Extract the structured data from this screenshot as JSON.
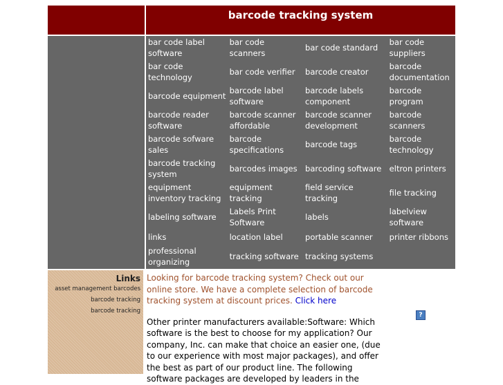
{
  "header": {
    "title": "barcode tracking system"
  },
  "nav_links": [
    [
      "bar code label software",
      "bar code scanners",
      "bar code standard",
      "bar code suppliers"
    ],
    [
      "bar code technology",
      "bar code verifier",
      "barcode creator",
      "barcode documentation"
    ],
    [
      "barcode equipment",
      "barcode label software",
      "barcode labels component",
      "barcode program"
    ],
    [
      "barcode reader software",
      "barcode scanner affordable",
      "barcode scanner development",
      "barcode scanners"
    ],
    [
      "barcode sofware sales",
      "barcode specifications",
      "barcode tags",
      "barcode technology"
    ],
    [
      "barcode tracking system",
      "barcodes images",
      "barcoding software",
      "eltron printers"
    ],
    [
      "equipment inventory tracking",
      "equipment tracking",
      "field service tracking",
      "file tracking"
    ],
    [
      "labeling software",
      "Labels Print Software",
      "labels",
      "labelview software"
    ],
    [
      "links",
      "location label",
      "portable scanner",
      "printer ribbons"
    ],
    [
      "professional organizing",
      "tracking software",
      "tracking systems",
      ""
    ]
  ],
  "sidebar": {
    "heading": "Links",
    "items": [
      "asset management barcodes",
      "barcode tracking",
      "barcode tracking"
    ]
  },
  "content": {
    "promo_text": "Looking for barcode tracking system? Check out our online store. We have a complete selection of barcode tracking system at discount prices.",
    "promo_link": "Click here",
    "body_text": "Other printer manufacturers available:Software: Which software is the best to choose for my application? Our company, Inc. can make that choice an easier one, (due to our experience with most major packages), and offer the best as part of our product line. The following software packages are developed by leaders in the",
    "help_icon_label": "?"
  },
  "colors": {
    "header_bg": "#800000",
    "nav_bg": "#666666",
    "sidebar_bg": "#d8b896",
    "promo_text": "#a0522d",
    "link": "#0000cc"
  }
}
